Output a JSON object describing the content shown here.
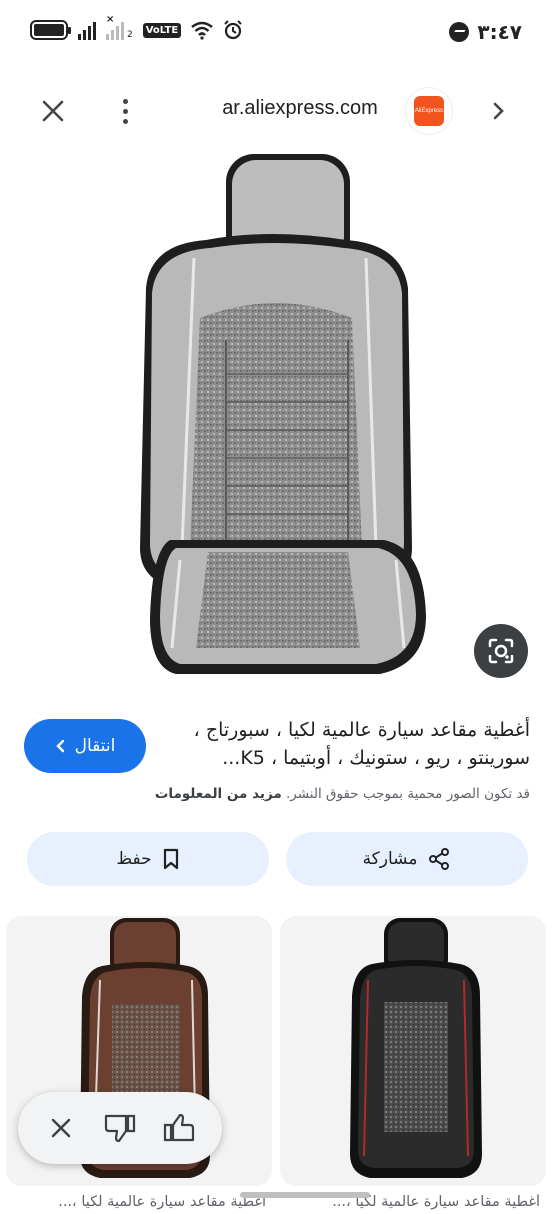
{
  "status_bar": {
    "time": "٣:٤٧",
    "network_label": "VoLTE",
    "sim2_label": "2"
  },
  "browser": {
    "url": "ar.aliexpress.com",
    "favicon_text": "AliExpress",
    "favicon_color": "#f1541c"
  },
  "result": {
    "visit_label": "انتقال",
    "title": "أغطية مقاعد سيارة عالمية لكيا ، سبورتاج ، سورينتو ، ريو ، ستونيك ، أوبتيما ، K5...",
    "copyright_text": "قد تكون الصور محمية بموجب حقوق النشر.",
    "more_info_label": "مزيد من المعلومات",
    "share_label": "مشاركة",
    "save_label": "حفظ"
  },
  "related": [
    {
      "caption": "أغطية مقاعد سيارة عالمية لكيا ،..."
    },
    {
      "caption": "أغطية مقاعد سيارة عالمية لكيا ،..."
    }
  ],
  "colors": {
    "accent": "#1a73e8",
    "pill_bg": "#e8f0fe"
  }
}
